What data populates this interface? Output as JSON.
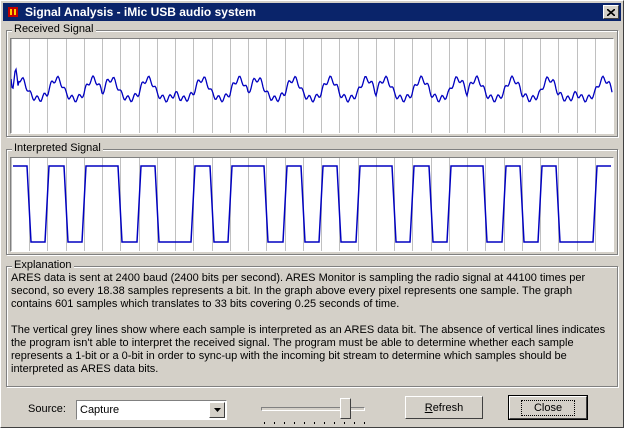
{
  "window": {
    "title": "Signal Analysis - iMic USB audio system"
  },
  "received": {
    "label": "Received Signal"
  },
  "interpreted": {
    "label": "Interpreted Signal"
  },
  "explanation": {
    "label": "Explanation",
    "paragraph1": "ARES data is sent at 2400 baud (2400 bits per second).  ARES Monitor is sampling the radio signal at 44100 times per second, so every 18.38 samples represents a bit.  In the graph above every pixel represents one sample.  The graph contains 601 samples which translates to 33 bits covering 0.25 seconds of time.",
    "paragraph2": "The vertical grey lines show where each sample is interpreted as an ARES data bit.  The absence of vertical lines indicates the program isn't able to interpret the received signal.  The program must be able to determine whether each sample represents a 1-bit or a 0-bit in order to sync-up with the incoming bit stream to determine which samples should be interpreted as ARES data bits."
  },
  "controls": {
    "source_label": "Source:",
    "source_value": "Capture",
    "slider_value": 0.85,
    "refresh_label": "Refresh",
    "close_label": "Close"
  },
  "signal": {
    "bits": [
      1,
      0,
      1,
      0,
      1,
      1,
      0,
      1,
      0,
      0,
      1,
      0,
      1,
      1,
      0,
      1,
      0,
      1,
      0,
      1,
      1,
      0,
      1,
      0,
      1,
      1,
      0,
      1,
      0,
      1,
      0,
      0,
      1
    ],
    "line_color": "#0000c0",
    "grid_color": "#c0c0c0"
  }
}
